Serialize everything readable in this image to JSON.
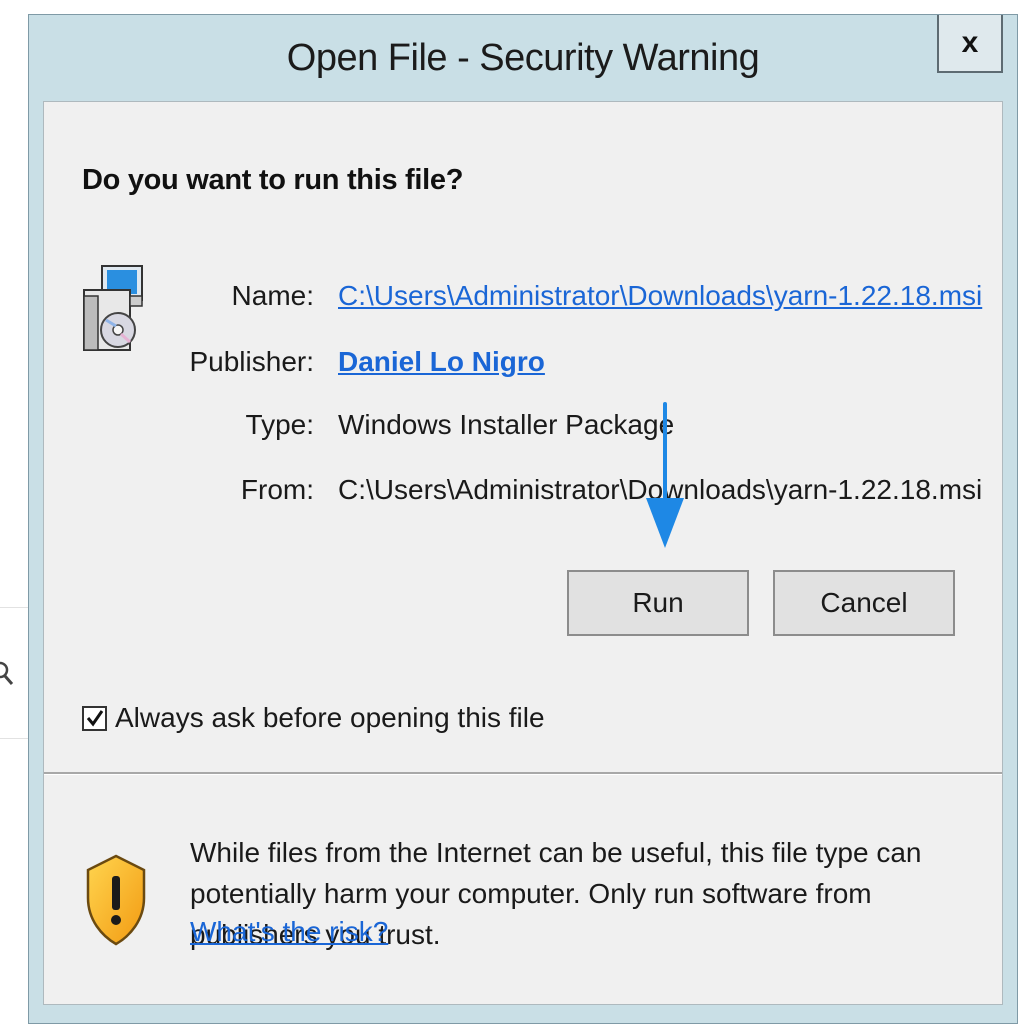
{
  "dialog": {
    "title": "Open File - Security Warning",
    "close_label": "x",
    "question": "Do you want to run this file?",
    "fields": {
      "name": {
        "label": "Name:",
        "value": "C:\\Users\\Administrator\\Downloads\\yarn-1.22.18.msi"
      },
      "publisher": {
        "label": "Publisher:",
        "value": "Daniel Lo Nigro"
      },
      "type": {
        "label": "Type:",
        "value": "Windows Installer Package"
      },
      "from": {
        "label": "From:",
        "value": "C:\\Users\\Administrator\\Downloads\\yarn-1.22.18.msi"
      }
    },
    "buttons": {
      "run": "Run",
      "cancel": "Cancel"
    },
    "checkbox": {
      "label": "Always ask before opening this file",
      "checked": true
    },
    "warning": {
      "text": "While files from the Internet can be useful, this file type can potentially harm your computer. Only run software from publishers you trust.",
      "link": "What's the risk?"
    }
  },
  "icons": {
    "installer": "msi-installer-icon",
    "shield": "warning-shield-icon",
    "close": "close-icon",
    "arrow": "pointer-arrow-icon",
    "search": "search-icon"
  },
  "colors": {
    "titlebar": "#c9dfe6",
    "client": "#f0f0f0",
    "link": "#1a66d6",
    "arrow": "#1e88e5"
  }
}
